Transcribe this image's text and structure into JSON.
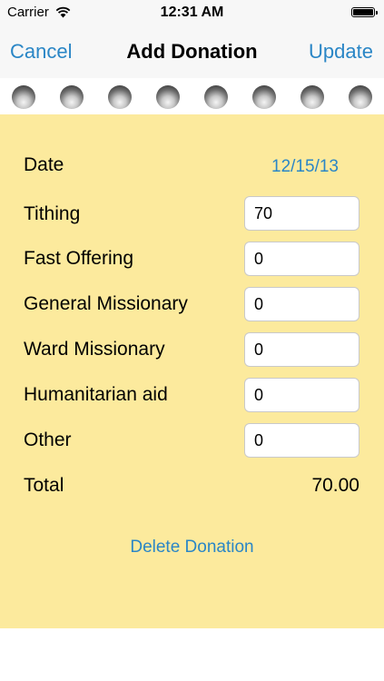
{
  "status_bar": {
    "carrier": "Carrier",
    "time": "12:31 AM"
  },
  "nav": {
    "cancel_label": "Cancel",
    "title": "Add Donation",
    "update_label": "Update"
  },
  "form": {
    "date_label": "Date",
    "date_value": "12/15/13",
    "fields": [
      {
        "label": "Tithing",
        "value": "70"
      },
      {
        "label": "Fast Offering",
        "value": "0"
      },
      {
        "label": "General Missionary",
        "value": "0"
      },
      {
        "label": "Ward Missionary",
        "value": "0"
      },
      {
        "label": "Humanitarian aid",
        "value": "0"
      },
      {
        "label": "Other",
        "value": "0"
      }
    ],
    "total_label": "Total",
    "total_value": "70.00",
    "delete_label": "Delete Donation"
  },
  "colors": {
    "accent": "#2a86c6",
    "paper": "#fcea9d",
    "bar": "#f7f7f7"
  }
}
